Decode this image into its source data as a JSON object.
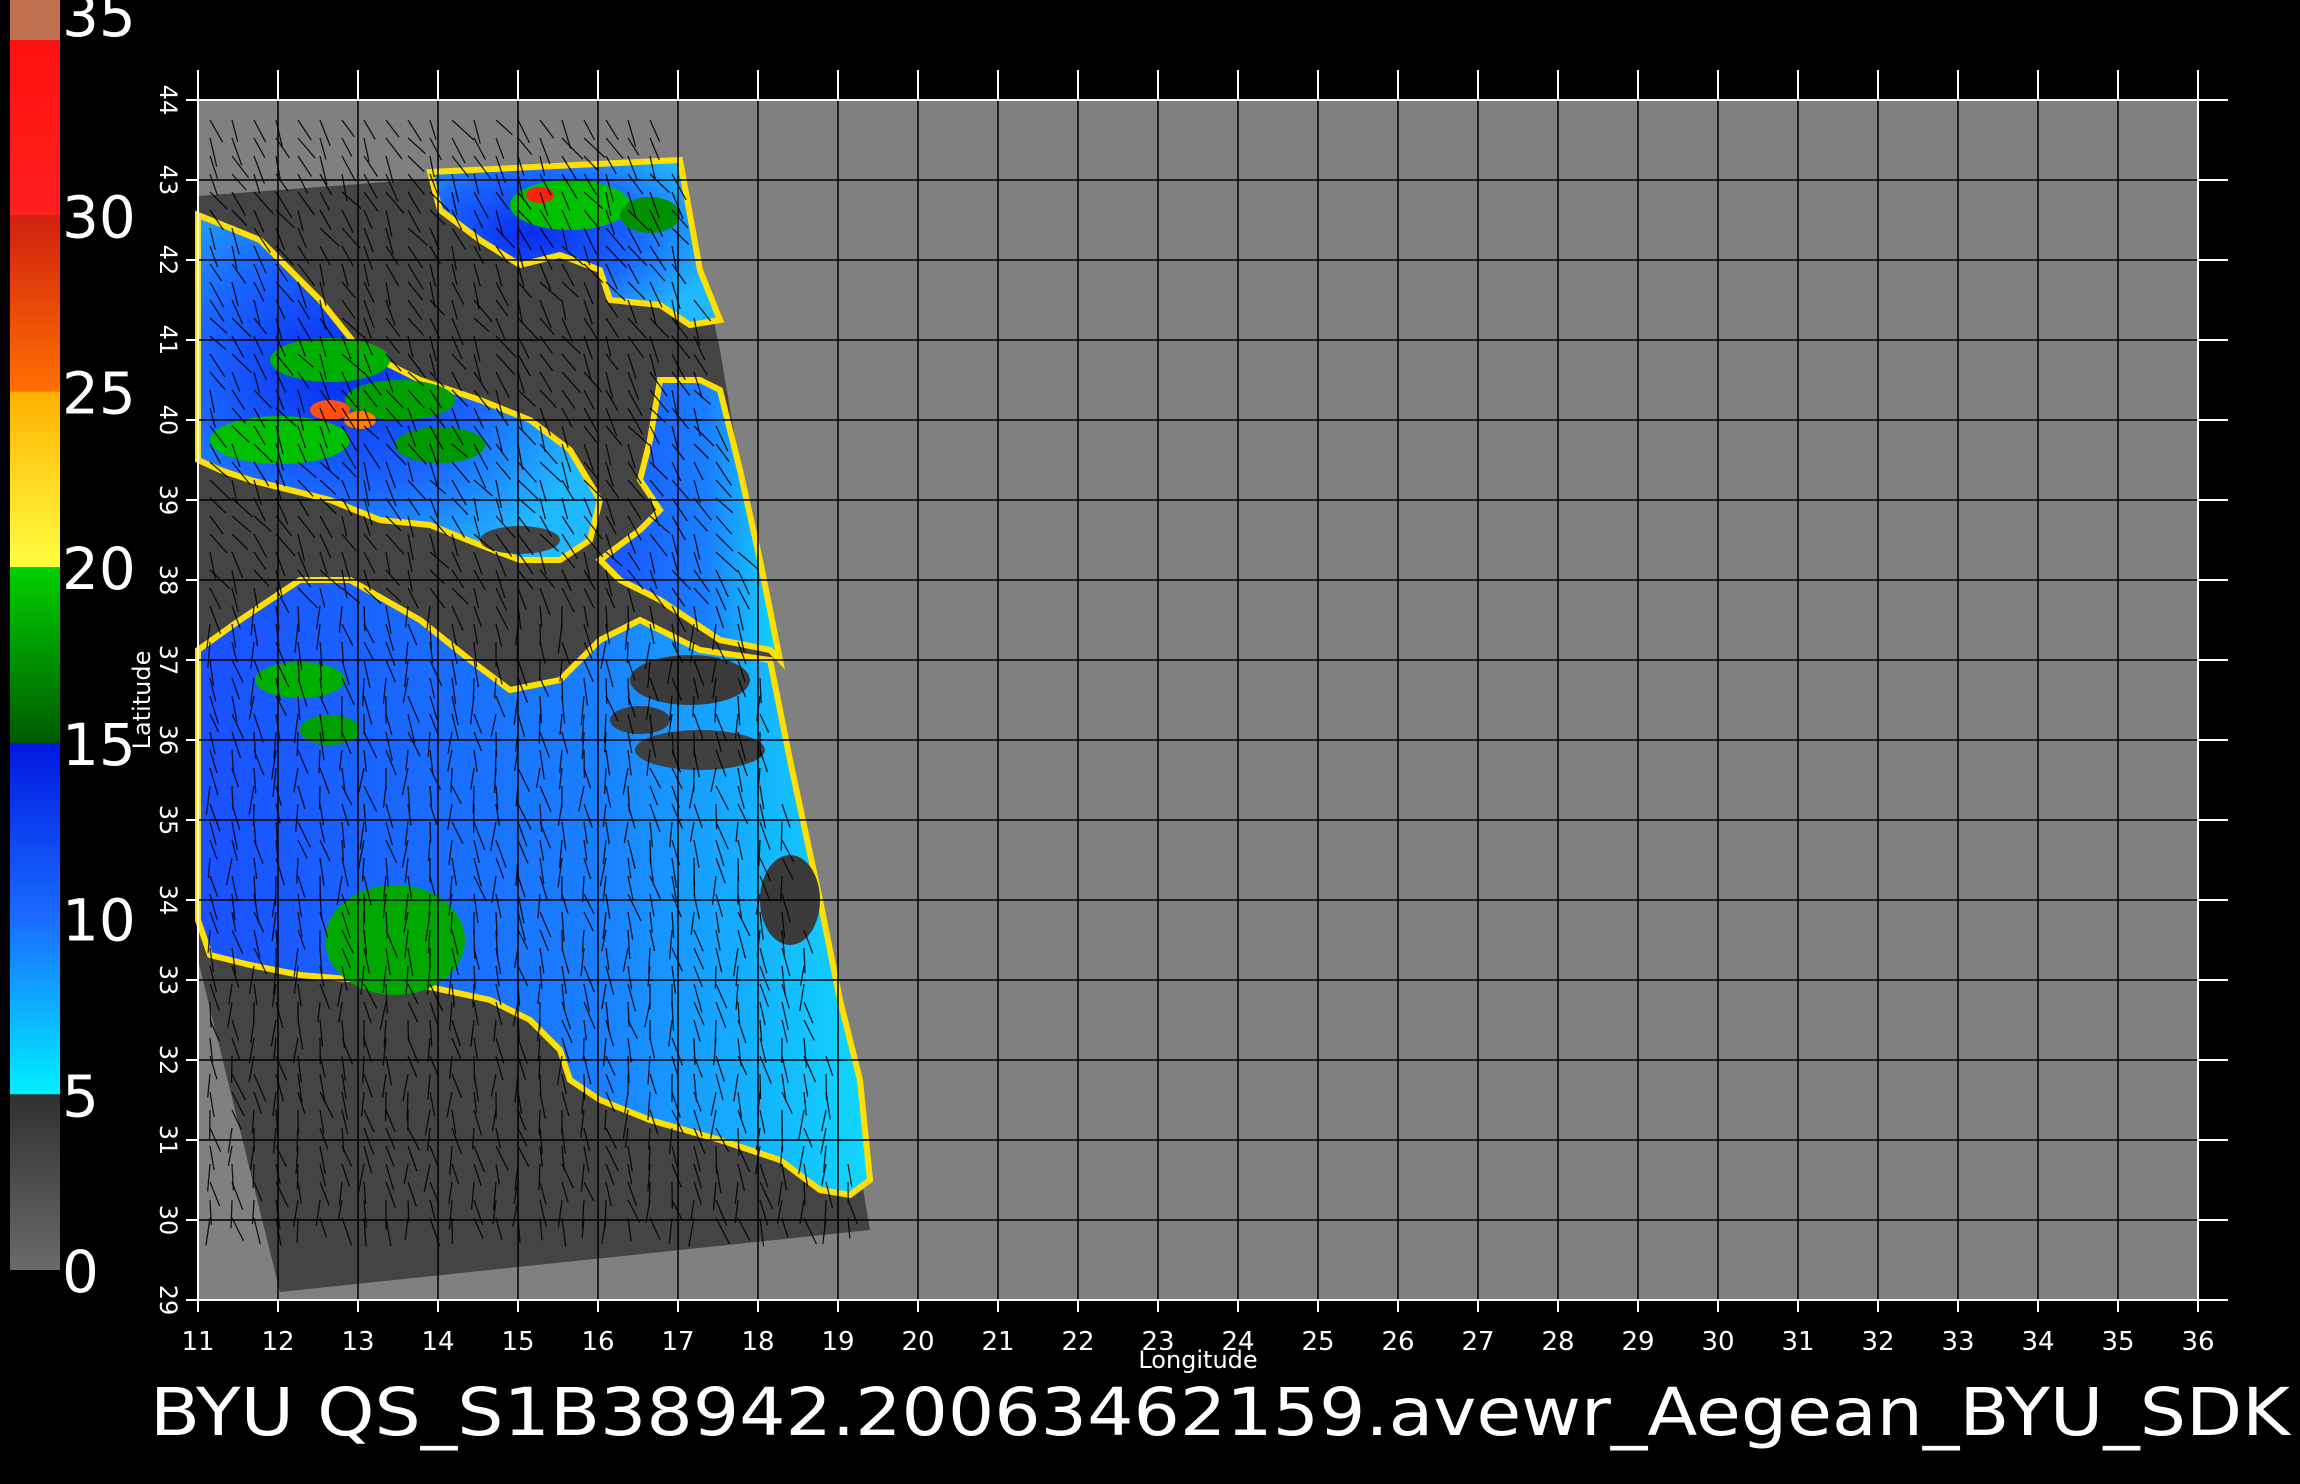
{
  "title": "BYU  QS_S1B38942.20063462159.avewr_Aegean_BYU_SDK",
  "x_axis_label": "Longitude",
  "y_axis_label": "Latitude",
  "longitude_ticks": [
    "11",
    "12",
    "13",
    "14",
    "15",
    "16",
    "17",
    "18",
    "19",
    "20",
    "21",
    "22",
    "23",
    "24",
    "25",
    "26",
    "27",
    "28",
    "29",
    "30",
    "31",
    "32",
    "33",
    "34",
    "35",
    "36"
  ],
  "latitude_ticks": [
    "29",
    "30",
    "31",
    "32",
    "33",
    "34",
    "35",
    "36",
    "37",
    "38",
    "39",
    "40",
    "41",
    "42",
    "43",
    "44"
  ],
  "colorbar": {
    "labels": [
      "0",
      "5",
      "10",
      "15",
      "20",
      "25",
      "30",
      "35"
    ],
    "bands": [
      {
        "from": 0,
        "to": 5,
        "top": "#303030",
        "bottom": "#6a6a6a"
      },
      {
        "from": 5,
        "to": 10,
        "top": "#1a6cff",
        "bottom": "#00f0ff"
      },
      {
        "from": 10,
        "to": 15,
        "top": "#0018e0",
        "bottom": "#1a6cff"
      },
      {
        "from": 15,
        "to": 20,
        "top": "#00d000",
        "bottom": "#005a00"
      },
      {
        "from": 20,
        "to": 25,
        "top": "#ffb000",
        "bottom": "#ffff40"
      },
      {
        "from": 25,
        "to": 30,
        "top": "#d02010",
        "bottom": "#ff7000"
      },
      {
        "from": 30,
        "to": 35,
        "top": "#ff1010",
        "bottom": "#ff2020"
      }
    ],
    "top_cap": "#c07050"
  },
  "colors": {
    "background": "#000000",
    "map_fill": "#808080",
    "swath_fill": "#444444",
    "grid": "#000000",
    "text": "#ffffff"
  }
}
